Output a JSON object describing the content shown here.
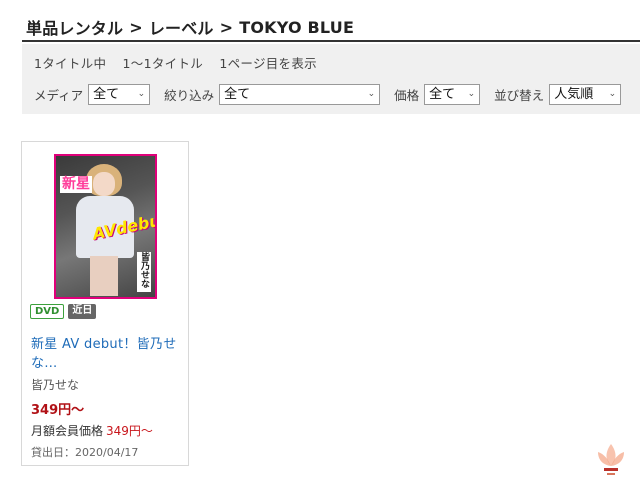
{
  "breadcrumb": {
    "items": [
      "単品レンタル",
      "レーベル",
      "TOKYO BLUE"
    ],
    "separator": ">"
  },
  "results": {
    "total": "1タイトル中",
    "range": "1〜1タイトル",
    "page": "1ページ目を表示"
  },
  "filters": {
    "media": {
      "label": "メディア",
      "value": "全て"
    },
    "narrow": {
      "label": "絞り込み",
      "value": "全て"
    },
    "price": {
      "label": "価格",
      "value": "全て"
    },
    "sort": {
      "label": "並び替え",
      "value": "人気順"
    }
  },
  "product": {
    "cover_text": {
      "shinsei": "新星",
      "debut": "AVdebut!",
      "name": "皆乃せな"
    },
    "badges": {
      "media": "DVD",
      "status": "近日"
    },
    "title": "新星 AV debut！皆乃せな…",
    "actress": "皆乃せな",
    "price": "349円〜",
    "member_price_label": "月額会員価格",
    "member_price": "349円〜",
    "release_date": "貸出日：2020/04/17"
  },
  "colors": {
    "link": "#1e6bb8",
    "price": "#b11116",
    "panel_bg": "#f0f0f0",
    "dvd_badge": "#3ca13c",
    "cover_border": "#e0007a"
  },
  "icons": {
    "select_chevron": "chevron-down-icon",
    "brand_logo": "lotus-logo"
  }
}
